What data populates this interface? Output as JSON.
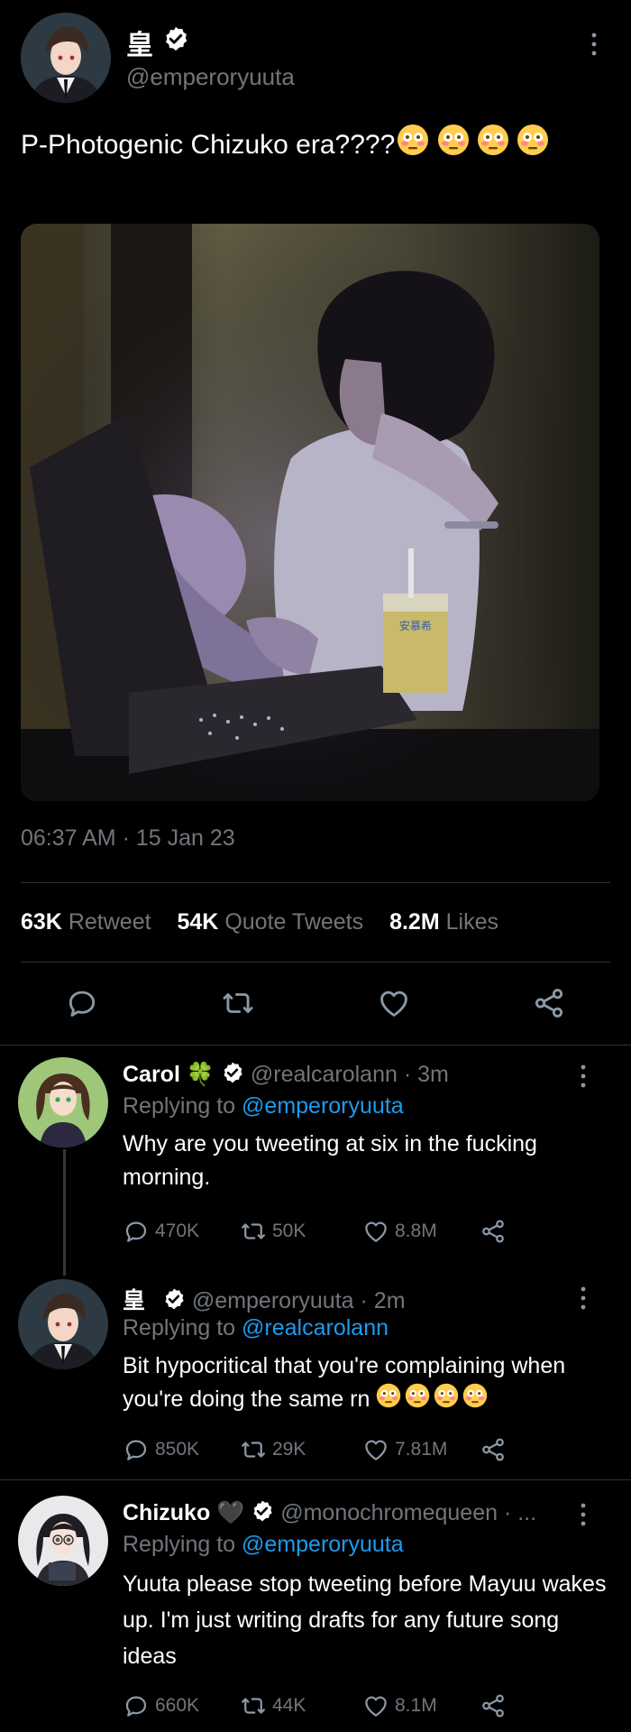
{
  "main_tweet": {
    "name": "皇",
    "handle": "@emperoryuuta",
    "text": "P-Photogenic Chizuko era????",
    "emoji_count": 4,
    "timestamp": "06:37 AM · 15 Jan 23",
    "counts": {
      "retweets_value": "63K",
      "retweets_label": "Retweet",
      "quotes_value": "54K",
      "quotes_label": "Quote Tweets",
      "likes_value": "8.2M",
      "likes_label": "Likes"
    },
    "photo_text": {
      "carton_label": "安慕希"
    }
  },
  "replies": [
    {
      "name": "Carol",
      "name_emoji": "🍀",
      "handle": "@realcarolann",
      "time": "· 3m",
      "replying_prefix": "Replying to",
      "replying_to": "@emperoryuuta",
      "text": "Why are you tweeting at six in the fucking morning.",
      "stats": {
        "replies": "470K",
        "retweets": "50K",
        "likes": "8.8M"
      }
    },
    {
      "name": "皇",
      "handle": "@emperoryuuta",
      "time": "· 2m",
      "replying_prefix": "Replying to",
      "replying_to": "@realcarolann",
      "text": "Bit hypocritical that you're complaining when you're doing the same rn",
      "stats": {
        "replies": "850K",
        "retweets": "29K",
        "likes": "7.81M"
      }
    },
    {
      "name": "Chizuko",
      "name_emoji": "🖤",
      "handle": "@monochromequeen · ...",
      "replying_prefix": "Replying to",
      "replying_to": "@emperoryuuta",
      "text": "Yuuta please stop tweeting before Mayuu wakes up. I'm just writing drafts for any future song ideas",
      "stats": {
        "replies": "660K",
        "retweets": "44K",
        "likes": "8.1M"
      }
    }
  ],
  "colors": {
    "background": "#000000",
    "text": "#e7e9ea",
    "muted": "#71767b",
    "link": "#1d9bf0",
    "divider": "#2f3336"
  },
  "icons": [
    "verified-badge-icon",
    "more-vertical-icon",
    "reply-icon",
    "retweet-icon",
    "like-icon",
    "share-icon",
    "flushed-face-emoji"
  ]
}
